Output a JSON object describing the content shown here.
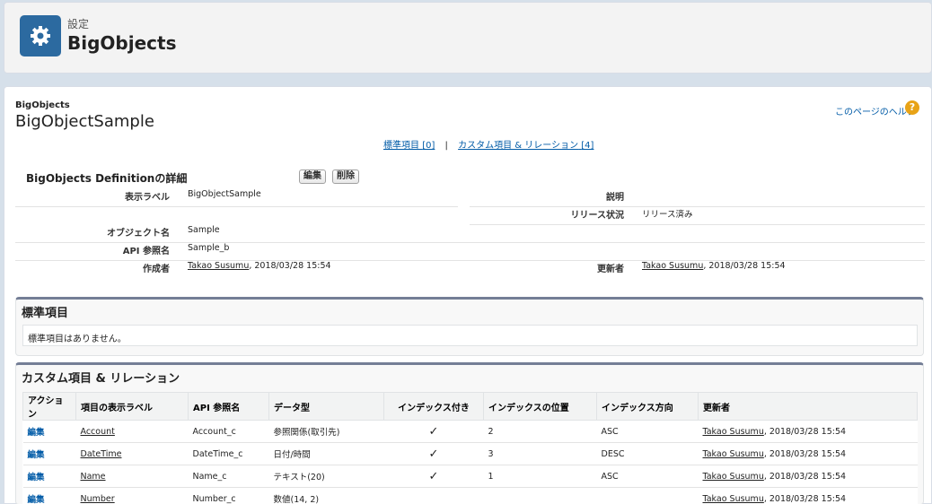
{
  "header": {
    "subtitle": "設定",
    "title": "BigObjects",
    "icon": "gear-icon",
    "icon_color": "#2c6aa0"
  },
  "page": {
    "breadcrumb": "BigObjects",
    "record_title": "BigObjectSample",
    "help_link": "このページのヘルプ",
    "related_links": [
      {
        "label": "標準項目",
        "count": "[0]"
      },
      {
        "label": "カスタム項目 & リレーション",
        "count": "[4]"
      }
    ],
    "separator": "|"
  },
  "detail": {
    "title": "BigObjects Definitionの詳細",
    "edit_button": "編集",
    "delete_button": "削除",
    "label_label": "表示ラベル",
    "label_value": "BigObjectSample",
    "description_label": "説明",
    "description_value": "",
    "release_status_label": "リリース状況",
    "release_status_value": "リリース済み",
    "object_name_label": "オブジェクト名",
    "object_name_value": "Sample",
    "api_name_label": "API 参照名",
    "api_name_value": "Sample_b",
    "created_by_label": "作成者",
    "created_by_user": "Takao Susumu",
    "created_by_date": ", 2018/03/28 15:54",
    "modified_by_label": "更新者",
    "modified_by_user": "Takao Susumu",
    "modified_by_date": ", 2018/03/28 15:54"
  },
  "standard_fields": {
    "title": "標準項目",
    "empty_message": "標準項目はありません。"
  },
  "custom_fields": {
    "title": "カスタム項目 & リレーション",
    "columns": [
      "アクション",
      "項目の表示ラベル",
      "API 参照名",
      "データ型",
      "インデックス付き",
      "インデックスの位置",
      "インデックス方向",
      "更新者"
    ],
    "rows": [
      {
        "action": "編集",
        "label": "Account",
        "api": "Account_c",
        "type": "参照関係(取引先)",
        "indexed": "✓",
        "position": "2",
        "direction": "ASC",
        "user": "Takao Susumu",
        "date": ", 2018/03/28 15:54"
      },
      {
        "action": "編集",
        "label": "DateTime",
        "api": "DateTime_c",
        "type": "日付/時間",
        "indexed": "✓",
        "position": "3",
        "direction": "DESC",
        "user": "Takao Susumu",
        "date": ", 2018/03/28 15:54"
      },
      {
        "action": "編集",
        "label": "Name",
        "api": "Name_c",
        "type": "テキスト(20)",
        "indexed": "✓",
        "position": "1",
        "direction": "ASC",
        "user": "Takao Susumu",
        "date": ", 2018/03/28 15:54"
      },
      {
        "action": "編集",
        "label": "Number",
        "api": "Number_c",
        "type": "数値(14, 2)",
        "indexed": "",
        "position": "",
        "direction": "",
        "user": "Takao Susumu",
        "date": ", 2018/03/28 15:54"
      }
    ]
  }
}
